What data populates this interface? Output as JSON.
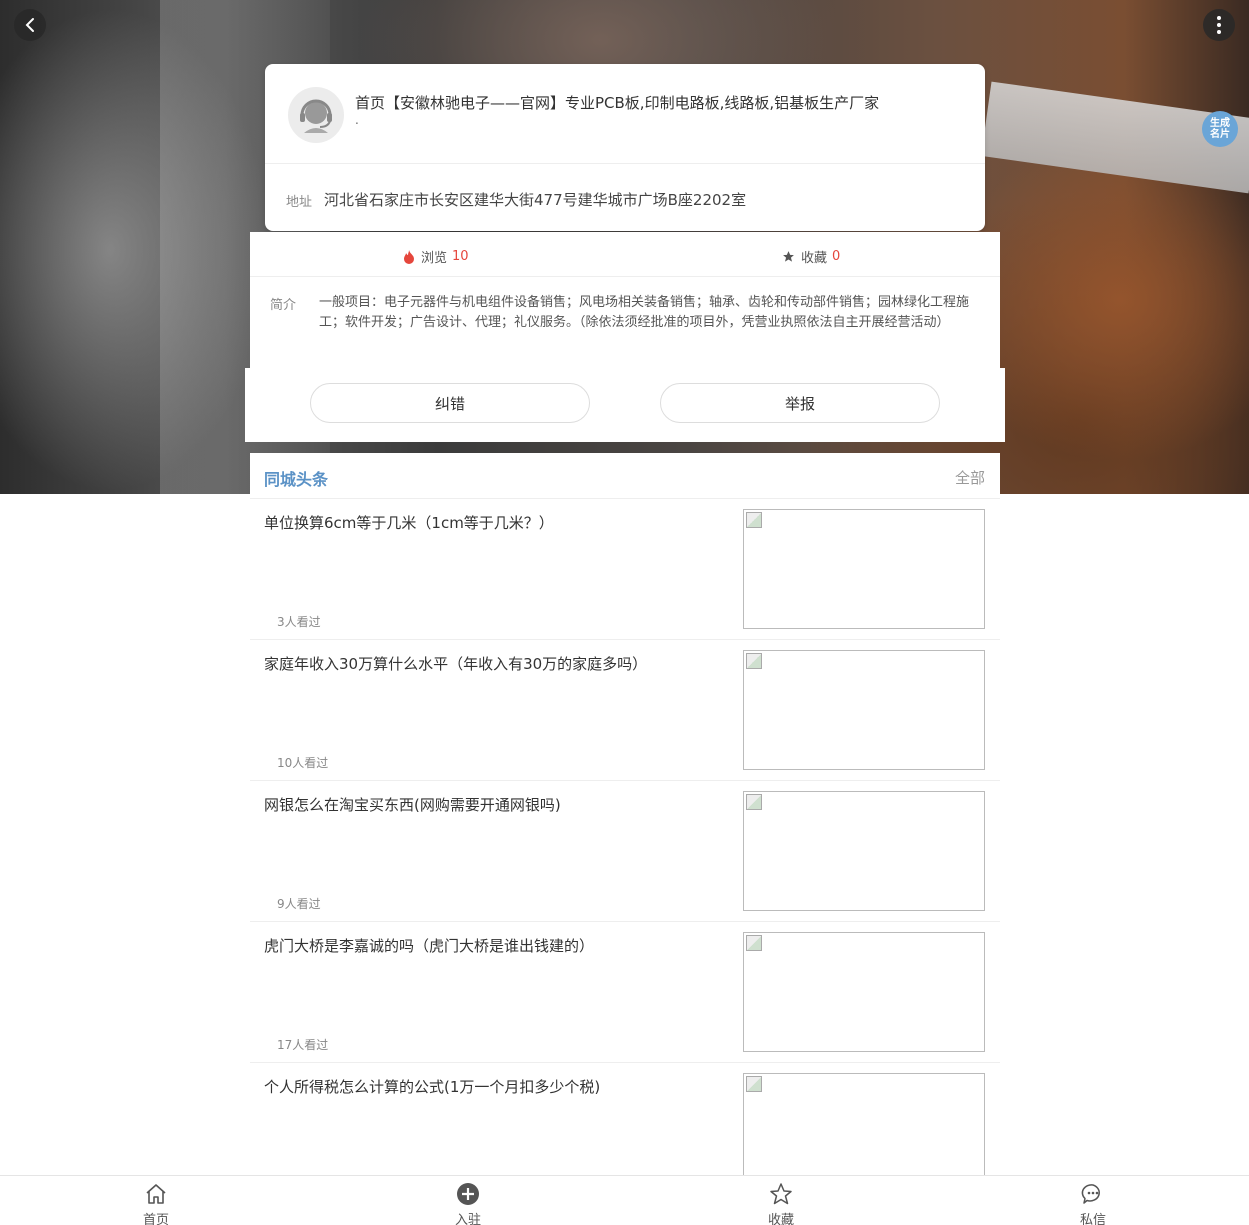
{
  "header": {
    "back_icon": "chevron-left-icon",
    "more_icon": "vertical-dots-icon",
    "card_button_label": "生成名片"
  },
  "company": {
    "name": "首页【安徽林驰电子——官网】专业PCB板,印制电路板,线路板,铝基板生产厂家",
    "name_suffix": ".",
    "address_label": "地址",
    "address": "河北省石家庄市长安区建华大街477号建华城市广场B座2202室"
  },
  "stats": {
    "views_label": "浏览",
    "views_count": "10",
    "favorites_label": "收藏",
    "favorites_count": "0"
  },
  "intro": {
    "label": "简介",
    "text": "一般项目：电子元器件与机电组件设备销售；风电场相关装备销售；轴承、齿轮和传动部件销售；园林绿化工程施工；软件开发；广告设计、代理；礼仪服务。（除依法须经批准的项目外，凭营业执照依法自主开展经营活动）"
  },
  "actions": {
    "correct_label": "纠错",
    "report_label": "举报"
  },
  "news": {
    "title": "同城头条",
    "all_label": "全部",
    "items": [
      {
        "title": "单位换算6cm等于几米（1cm等于几米？）",
        "views": "3人看过"
      },
      {
        "title": "家庭年收入30万算什么水平（年收入有30万的家庭多吗）",
        "views": "10人看过"
      },
      {
        "title": "网银怎么在淘宝买东西(网购需要开通网银吗)",
        "views": "9人看过"
      },
      {
        "title": "虎门大桥是李嘉诚的吗（虎门大桥是谁出钱建的）",
        "views": "17人看过"
      },
      {
        "title": "个人所得税怎么计算的公式(1万一个月扣多少个税)",
        "views": ""
      }
    ]
  },
  "tabbar": {
    "home": "首页",
    "join": "入驻",
    "favorites": "收藏",
    "messages": "私信"
  },
  "colors": {
    "accent_blue": "#5b92c6",
    "count_red": "#e5463c",
    "card_button": "#6aa5d7"
  }
}
